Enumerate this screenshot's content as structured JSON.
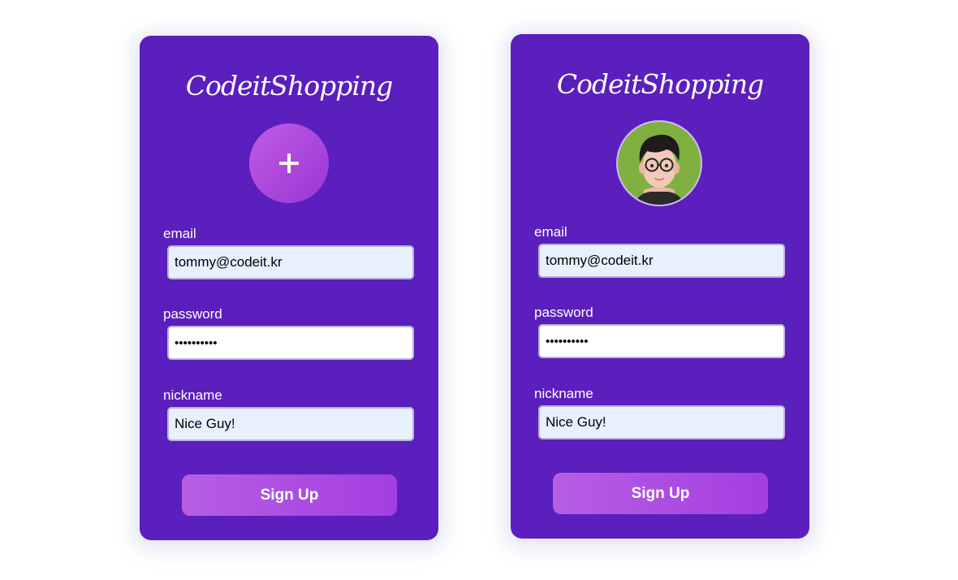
{
  "cards": [
    {
      "brand": "CodeitShopping",
      "avatar": {
        "state": "empty",
        "icon": "plus-icon"
      },
      "email": {
        "label": "email",
        "value": "tommy@codeit.kr"
      },
      "password": {
        "label": "password",
        "value": "••••••••••"
      },
      "nickname": {
        "label": "nickname",
        "value": "Nice Guy!"
      },
      "submit_label": "Sign Up"
    },
    {
      "brand": "CodeitShopping",
      "avatar": {
        "state": "uploaded",
        "icon": "profile-photo"
      },
      "email": {
        "label": "email",
        "value": "tommy@codeit.kr"
      },
      "password": {
        "label": "password",
        "value": "••••••••••"
      },
      "nickname": {
        "label": "nickname",
        "value": "Nice Guy!"
      },
      "submit_label": "Sign Up"
    }
  ],
  "colors": {
    "card_background": "#5a1fbd",
    "accent_gradient_start": "#b65ee4",
    "accent_gradient_end": "#a43ee0",
    "field_autofill": "#e8f0fe",
    "text": "#ffffff"
  }
}
